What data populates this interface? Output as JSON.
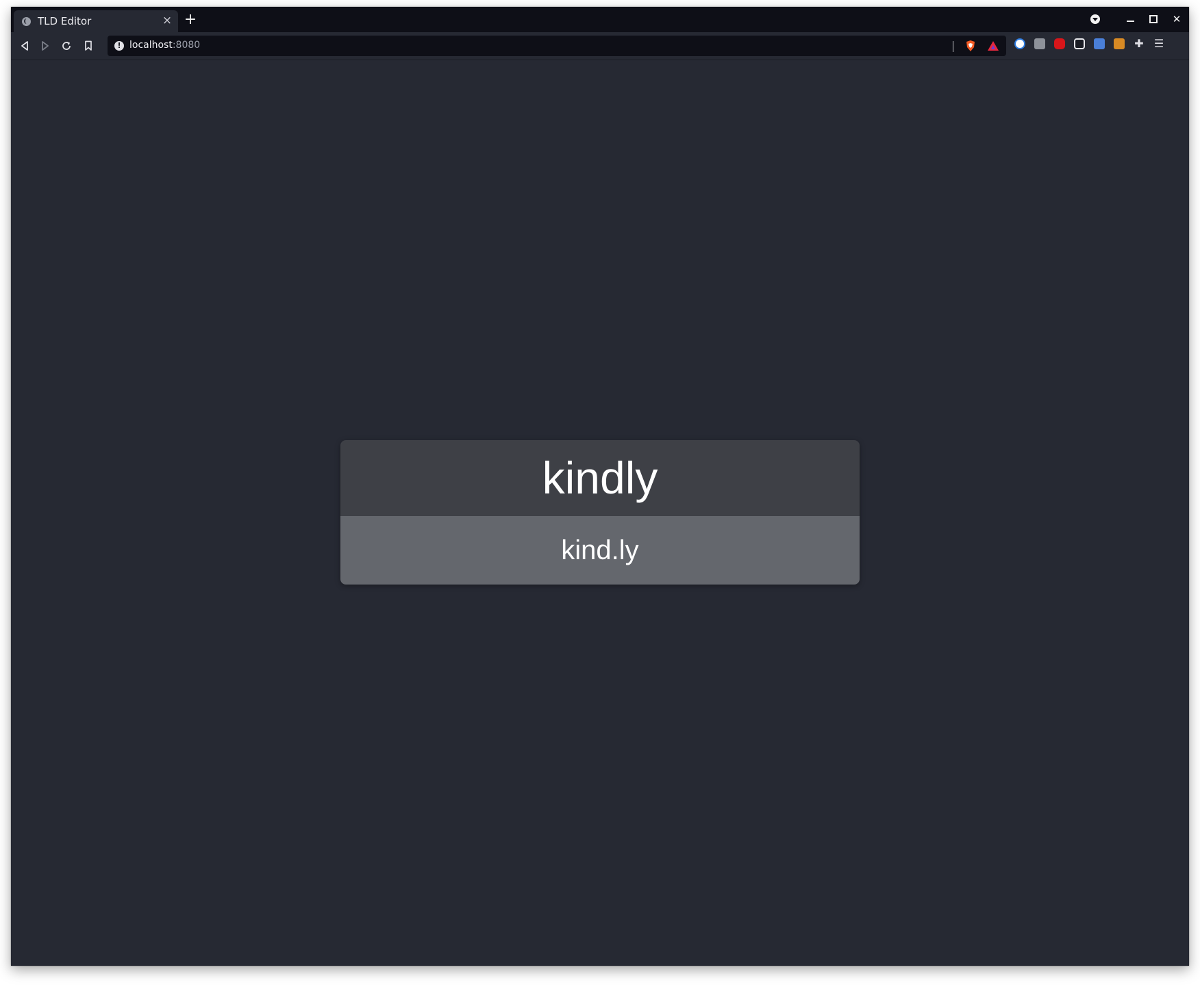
{
  "browser": {
    "tab": {
      "title": "TLD Editor",
      "close_glyph": "×"
    },
    "new_tab_glyph": "+",
    "url": {
      "host": "localhost",
      "port": ":8080"
    },
    "window_controls": {
      "minimize": "",
      "maximize": "",
      "close": "✕"
    },
    "extensions": [
      "1password-icon",
      "grey-extension-icon",
      "red-mask-icon",
      "reader-icon",
      "translate-icon",
      "orange-extension-icon",
      "puzzle-icon",
      "menu-icon"
    ]
  },
  "card": {
    "word": "kindly",
    "domain": "kind.ly"
  },
  "colors": {
    "background": "#262933",
    "tabbar": "#0e0f17",
    "card_top": "#3e4046",
    "card_bottom": "#64676d"
  }
}
